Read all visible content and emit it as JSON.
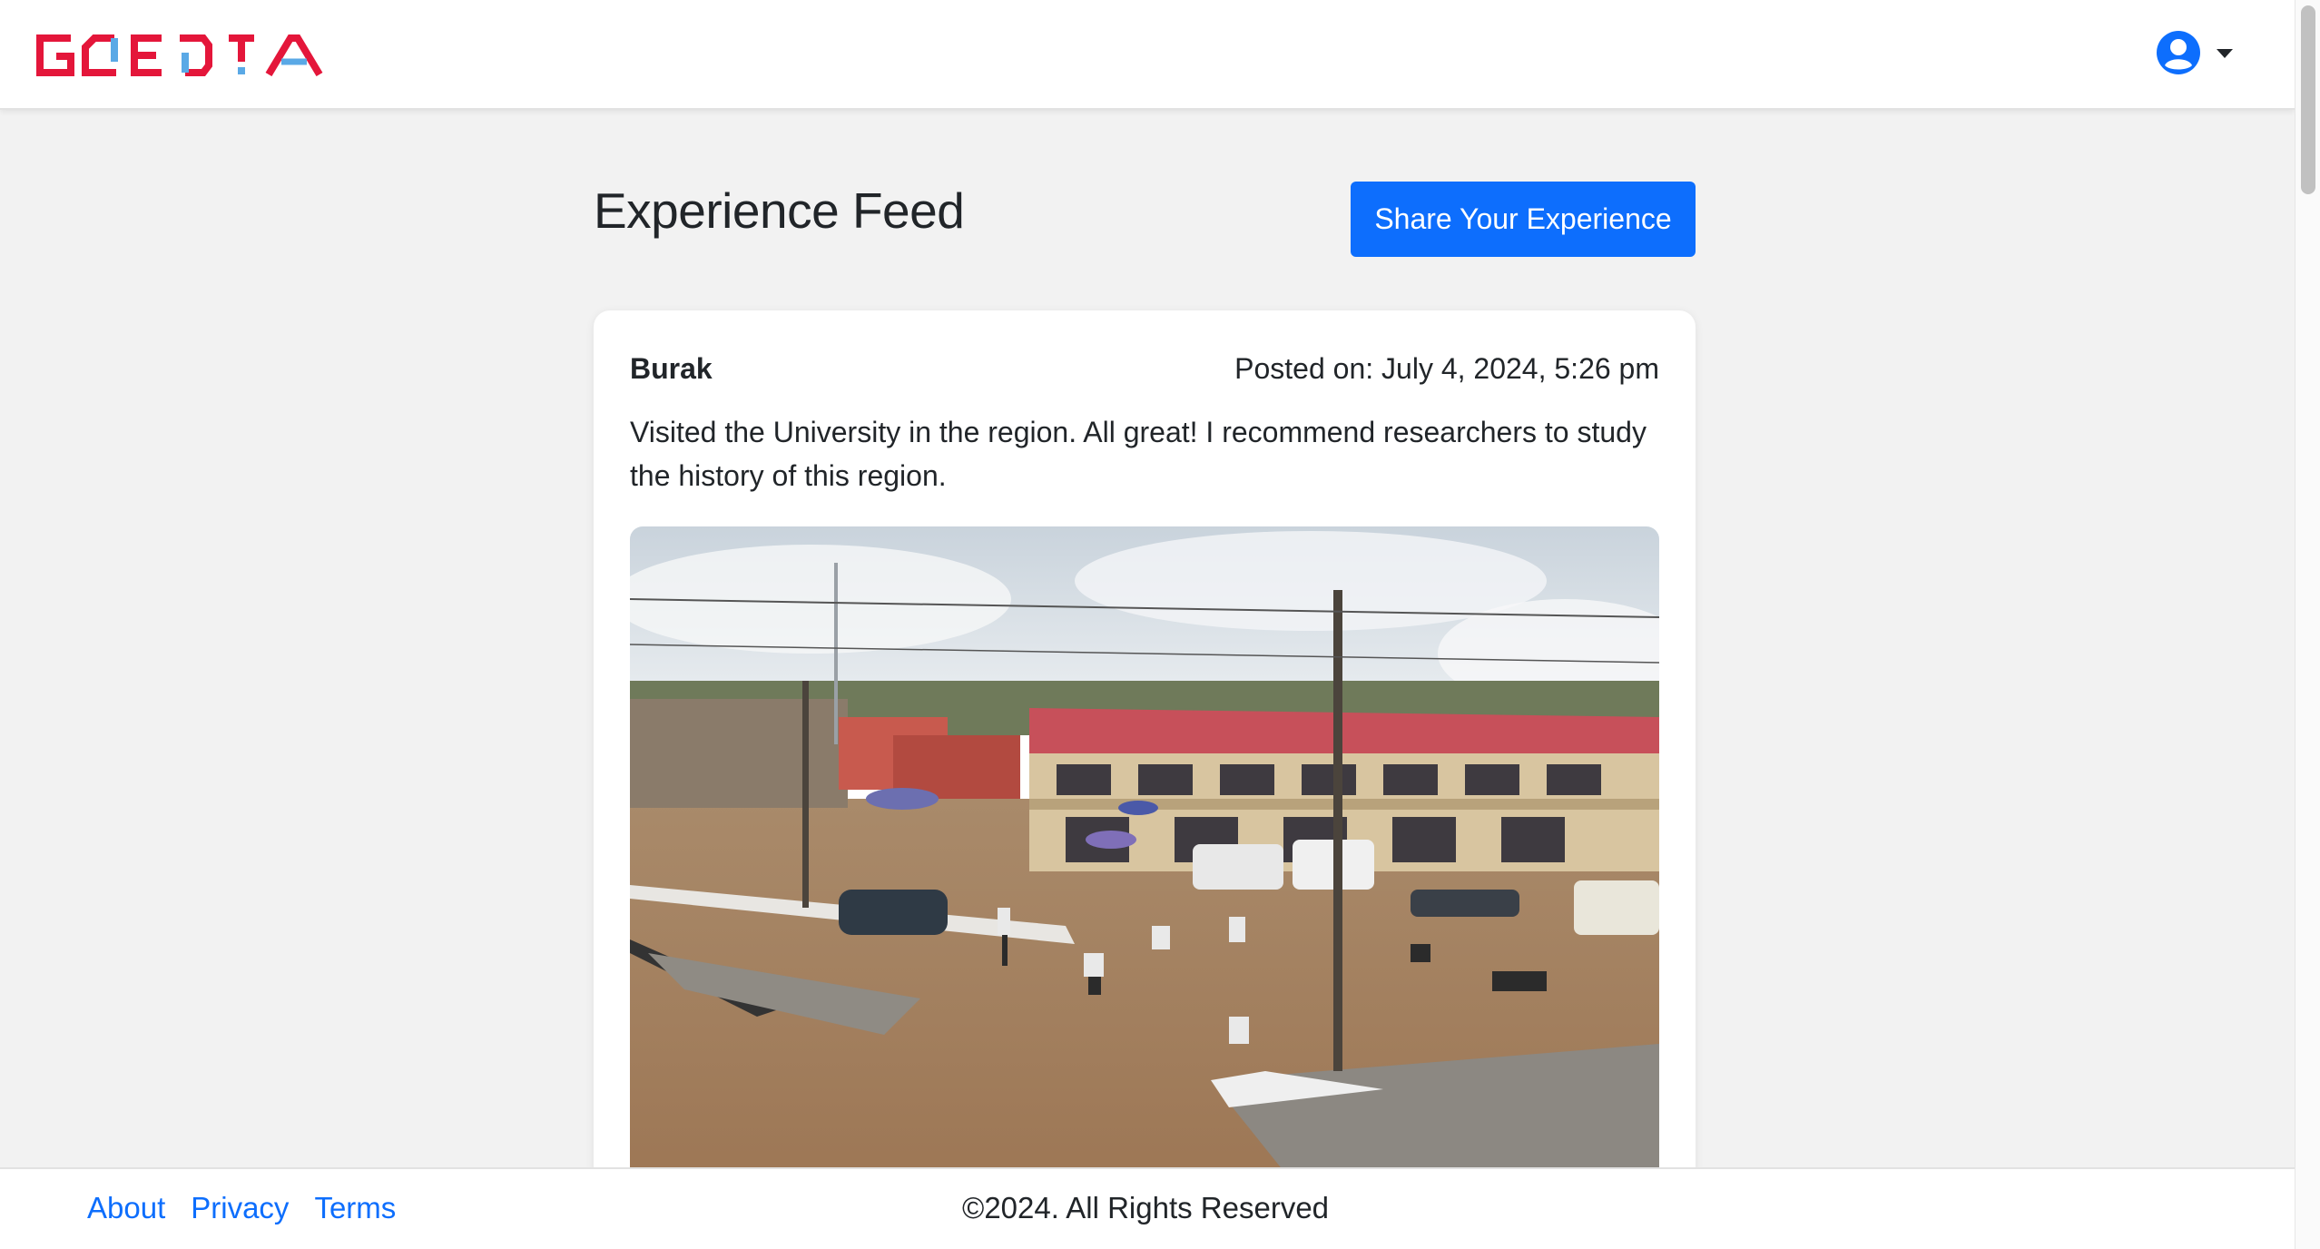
{
  "header": {
    "logo_text": "GOEDIA",
    "user_icon": "user-circle-icon",
    "dropdown_icon": "caret-down-icon"
  },
  "feed": {
    "title": "Experience Feed",
    "share_button": "Share Your Experience"
  },
  "posts": [
    {
      "author": "Burak",
      "date": "Posted on: July 4, 2024, 5:26 pm",
      "text": "Visited the University in the region. All great! I recommend researchers to study the history of this region."
    }
  ],
  "footer": {
    "links": [
      "About",
      "Privacy",
      "Terms"
    ],
    "copyright": "©2024. All Rights Reserved"
  },
  "colors": {
    "primary": "#0d6efd",
    "logo_red": "#e4163a",
    "logo_blue": "#5aa9e6",
    "background": "#f2f2f2"
  }
}
